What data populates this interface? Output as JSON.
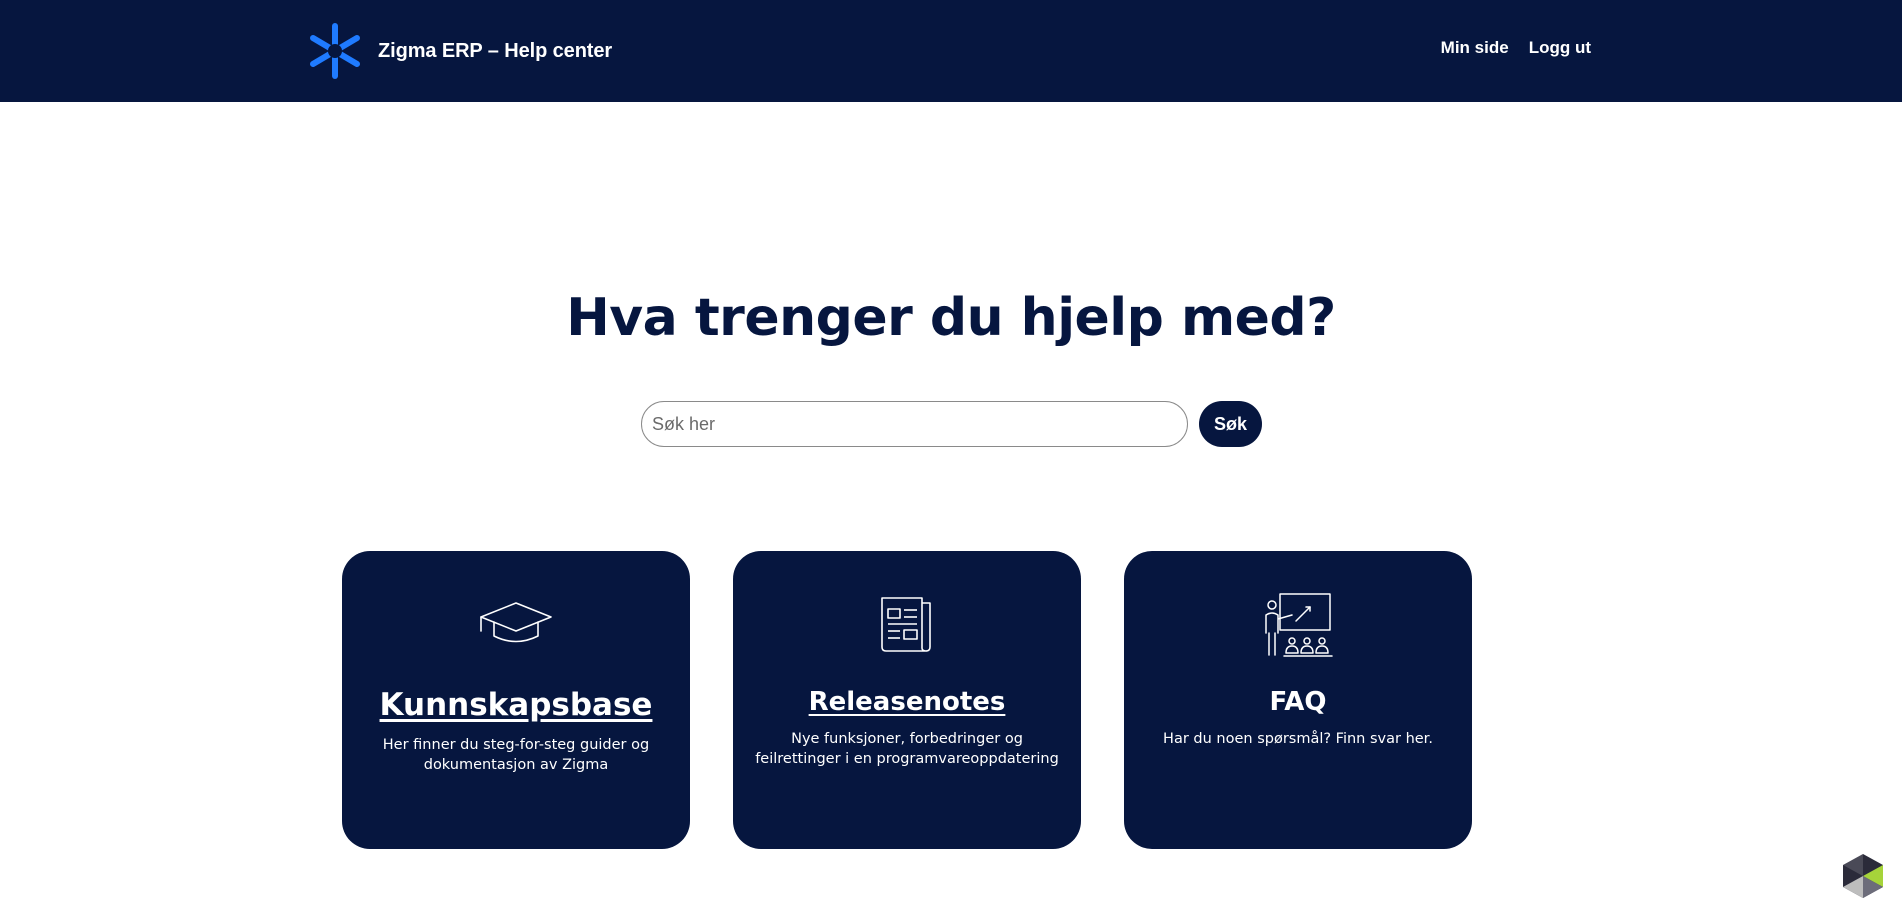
{
  "header": {
    "brand_name": "Zigma ERP – Help center",
    "logo_icon": "asterisk-logo-icon",
    "nav": [
      {
        "label": "Min side"
      },
      {
        "label": "Logg ut"
      }
    ]
  },
  "hero": {
    "title": "Hva trenger du hjelp med?"
  },
  "search": {
    "placeholder": "Søk her",
    "value": "",
    "button_label": "Søk"
  },
  "cards": [
    {
      "title": "Kunnskapsbase",
      "description": "Her finner du steg-for-steg guider og dokumentasjon av Zigma",
      "icon": "graduation-cap-icon"
    },
    {
      "title": "Releasenotes",
      "description": "Nye funksjoner, forbedringer og feilrettinger i en programvareoppdatering",
      "icon": "newspaper-icon"
    },
    {
      "title": "FAQ",
      "description": "Har du noen spørsmål? Finn svar her.",
      "icon": "teacher-presentation-icon"
    }
  ],
  "colors": {
    "navy": "#06163f",
    "accent_blue": "#1f7bff",
    "white": "#ffffff"
  },
  "widget": {
    "icon": "cube-widget-icon"
  }
}
